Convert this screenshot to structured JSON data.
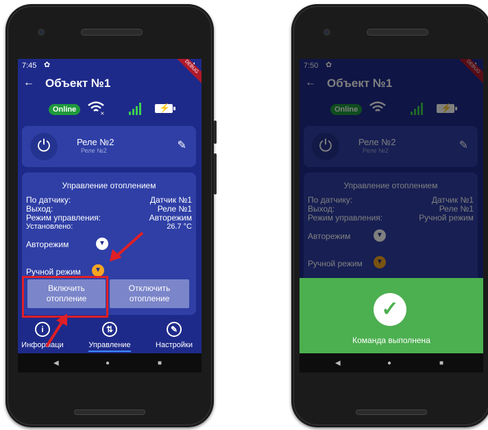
{
  "left_screen": {
    "time": "7:45",
    "title": "Объект №1",
    "online": "Online",
    "relay": {
      "name": "Реле №2",
      "subtitle": "Реле №2"
    },
    "control": {
      "header": "Управление отоплением",
      "sensor_label": "По датчику:",
      "sensor_value": "Датчик №1",
      "output_label": "Выход:",
      "output_value": "Реле №1",
      "mode_label": "Режим управления:",
      "mode_value": "Авторежим",
      "set_label": "Установлено:",
      "set_value": "26.7 °C",
      "auto_label": "Авторежим",
      "manual_label": "Ручной режим",
      "enable_button": "Включить\nотопление",
      "disable_button": "Отключить\nотопление"
    },
    "tabs": [
      "Информаци",
      "Управление",
      "Настройки"
    ],
    "debug_label": "DEBUG"
  },
  "right_screen": {
    "time": "7:50",
    "title": "Объект №1",
    "online": "Online",
    "relay": {
      "name": "Реле №2",
      "subtitle": "Реле №2"
    },
    "control": {
      "header": "Управление отоплением",
      "sensor_label": "По датчику:",
      "sensor_value": "Датчик №1",
      "output_label": "Выход:",
      "output_value": "Реле №1",
      "mode_label": "Режим управления:",
      "mode_value": "Ручной режим",
      "auto_label": "Авторежим",
      "manual_label": "Ручной режим"
    },
    "snackbar": "Команда выполнена",
    "debug_label": "DEBUG"
  },
  "colors": {
    "screen_bg": "#1e2a8a",
    "card_bg": "#2f3fa6",
    "highlight": "#e01f26",
    "success": "#4caf50",
    "online": "#1f9a3c"
  }
}
